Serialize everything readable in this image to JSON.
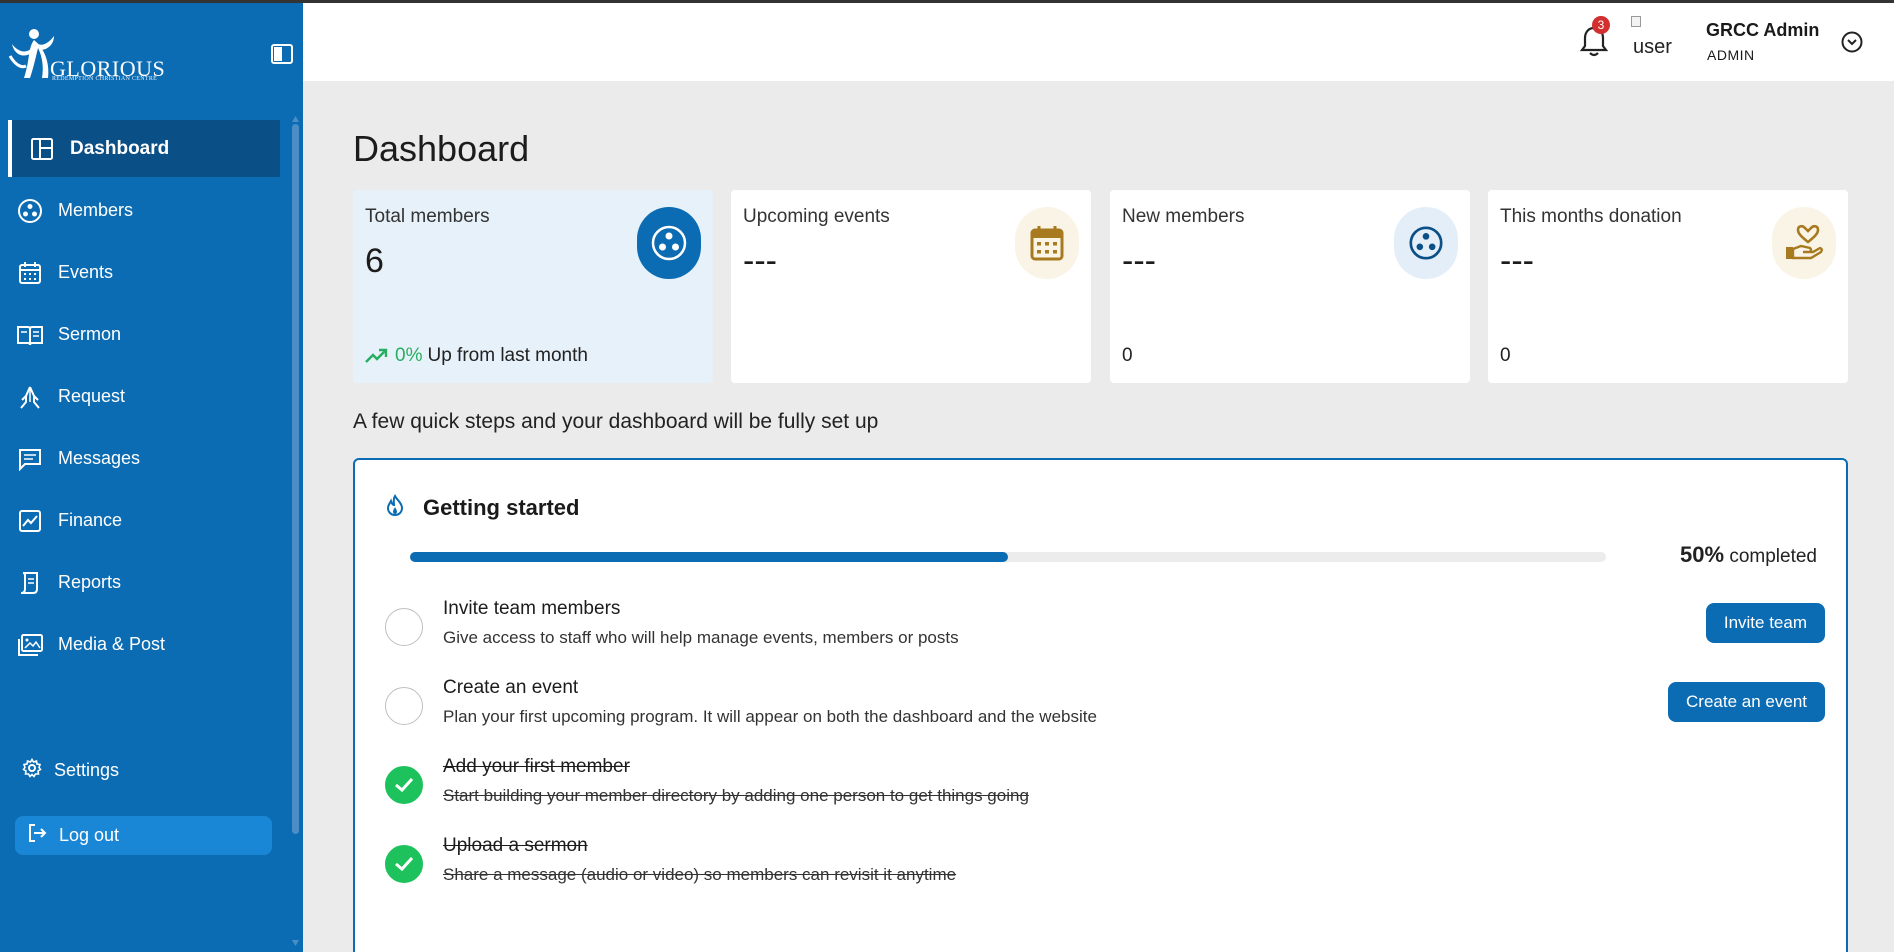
{
  "app": {
    "brand_name": "GLORIOUS",
    "brand_tagline": "REDEMPTION CHRISTIAN CENTRE"
  },
  "sidebar": {
    "items": [
      {
        "label": "Dashboard",
        "icon": "dashboard-icon",
        "active": true
      },
      {
        "label": "Members",
        "icon": "members-icon",
        "active": false
      },
      {
        "label": "Events",
        "icon": "calendar-icon",
        "active": false
      },
      {
        "label": "Sermon",
        "icon": "book-icon",
        "active": false
      },
      {
        "label": "Request",
        "icon": "praying-hands-icon",
        "active": false
      },
      {
        "label": "Messages",
        "icon": "message-icon",
        "active": false
      },
      {
        "label": "Finance",
        "icon": "chart-icon",
        "active": false
      },
      {
        "label": "Reports",
        "icon": "report-icon",
        "active": false
      },
      {
        "label": "Media & Post",
        "icon": "media-icon",
        "active": false
      }
    ],
    "settings_label": "Settings",
    "logout_label": "Log out"
  },
  "header": {
    "notification_count": "3",
    "avatar_alt": "user",
    "user_name": "GRCC Admin",
    "user_role": "ADMIN"
  },
  "main": {
    "title": "Dashboard",
    "cards": [
      {
        "label": "Total members",
        "value": "6",
        "foot_pct": "0%",
        "foot_text": "Up from last month",
        "icon": "members-icon"
      },
      {
        "label": "Upcoming events",
        "value": "---",
        "foot_text": "",
        "icon": "calendar-icon"
      },
      {
        "label": "New members",
        "value": "---",
        "foot_text": "0",
        "icon": "members-icon"
      },
      {
        "label": "This months donation",
        "value": "---",
        "foot_text": "0",
        "icon": "donation-hand-icon"
      }
    ],
    "quick_steps_text": "A few quick steps and your dashboard will be fully set up",
    "getting_started": {
      "title": "Getting started",
      "progress_value": "50%",
      "progress_fraction": 0.5,
      "progress_suffix": "completed",
      "steps": [
        {
          "title": "Invite team members",
          "desc": "Give access to staff who will help manage events, members or posts",
          "done": false,
          "button": "Invite team"
        },
        {
          "title": "Create an event",
          "desc": "Plan your first upcoming program. It will appear on both the dashboard and the website",
          "done": false,
          "button": "Create an event"
        },
        {
          "title": "Add your first member",
          "desc": "Start building your member directory by adding one person to get things going",
          "done": true,
          "button": ""
        },
        {
          "title": "Upload a sermon",
          "desc": "Share a message (audio or video) so members can revisit it anytime",
          "done": true,
          "button": ""
        }
      ]
    }
  },
  "colors": {
    "sidebar_bg": "#0c6cb3",
    "active_bg": "#0a4f86",
    "accent": "#0c6cb3",
    "success": "#1ec25c",
    "gold": "#a87a1f",
    "badge": "#d32f2f"
  }
}
